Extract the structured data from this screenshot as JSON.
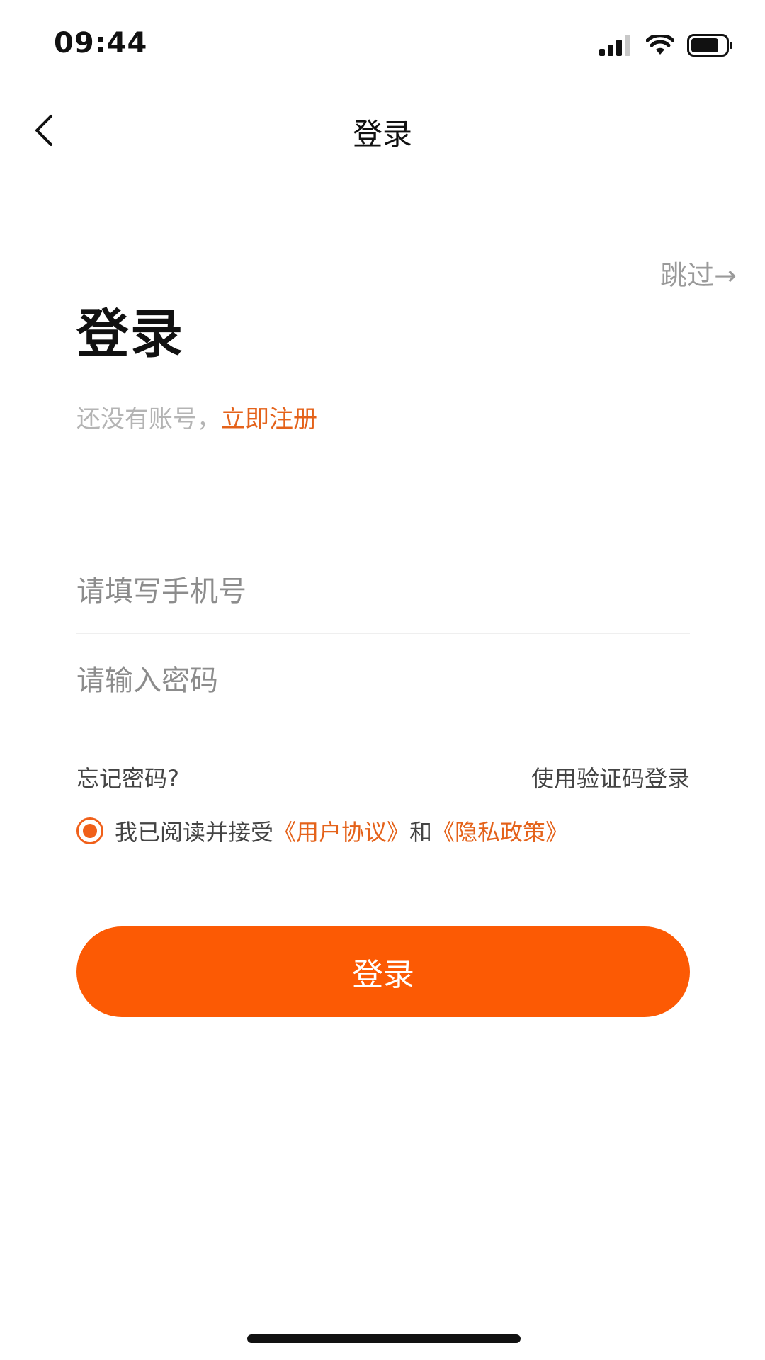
{
  "status_bar": {
    "time": "09:44",
    "icons": [
      "signal-icon",
      "wifi-icon",
      "battery-icon"
    ]
  },
  "nav": {
    "back_icon": "chevron-left-icon",
    "title": "登录"
  },
  "skip": {
    "label": "跳过→"
  },
  "heading": {
    "title": "登录",
    "prompt": "还没有账号，",
    "register_link": "立即注册"
  },
  "form": {
    "phone": {
      "value": "",
      "placeholder": "请填写手机号"
    },
    "password": {
      "value": "",
      "placeholder": "请输入密码"
    },
    "forgot_password": "忘记密码?",
    "code_login": "使用验证码登录"
  },
  "agreement": {
    "checked": true,
    "prefix": "我已阅读并接受",
    "user_agreement": "《用户协议》",
    "conjunction": "和",
    "privacy_policy": "《隐私政策》"
  },
  "login_button": {
    "label": "登录"
  },
  "colors": {
    "accent": "#fc5a04",
    "link": "#e4621a",
    "placeholder": "#8c8c8c",
    "muted": "#b4b4b4"
  }
}
